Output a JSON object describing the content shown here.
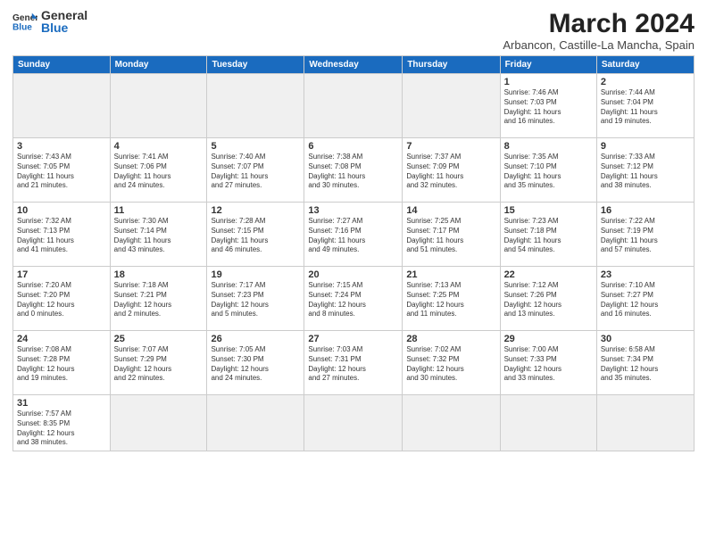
{
  "header": {
    "logo_general": "General",
    "logo_blue": "Blue",
    "month_title": "March 2024",
    "location": "Arbancon, Castille-La Mancha, Spain"
  },
  "weekdays": [
    "Sunday",
    "Monday",
    "Tuesday",
    "Wednesday",
    "Thursday",
    "Friday",
    "Saturday"
  ],
  "weeks": [
    [
      {
        "day": "",
        "info": ""
      },
      {
        "day": "",
        "info": ""
      },
      {
        "day": "",
        "info": ""
      },
      {
        "day": "",
        "info": ""
      },
      {
        "day": "",
        "info": ""
      },
      {
        "day": "1",
        "info": "Sunrise: 7:46 AM\nSunset: 7:03 PM\nDaylight: 11 hours\nand 16 minutes."
      },
      {
        "day": "2",
        "info": "Sunrise: 7:44 AM\nSunset: 7:04 PM\nDaylight: 11 hours\nand 19 minutes."
      }
    ],
    [
      {
        "day": "3",
        "info": "Sunrise: 7:43 AM\nSunset: 7:05 PM\nDaylight: 11 hours\nand 21 minutes."
      },
      {
        "day": "4",
        "info": "Sunrise: 7:41 AM\nSunset: 7:06 PM\nDaylight: 11 hours\nand 24 minutes."
      },
      {
        "day": "5",
        "info": "Sunrise: 7:40 AM\nSunset: 7:07 PM\nDaylight: 11 hours\nand 27 minutes."
      },
      {
        "day": "6",
        "info": "Sunrise: 7:38 AM\nSunset: 7:08 PM\nDaylight: 11 hours\nand 30 minutes."
      },
      {
        "day": "7",
        "info": "Sunrise: 7:37 AM\nSunset: 7:09 PM\nDaylight: 11 hours\nand 32 minutes."
      },
      {
        "day": "8",
        "info": "Sunrise: 7:35 AM\nSunset: 7:10 PM\nDaylight: 11 hours\nand 35 minutes."
      },
      {
        "day": "9",
        "info": "Sunrise: 7:33 AM\nSunset: 7:12 PM\nDaylight: 11 hours\nand 38 minutes."
      }
    ],
    [
      {
        "day": "10",
        "info": "Sunrise: 7:32 AM\nSunset: 7:13 PM\nDaylight: 11 hours\nand 41 minutes."
      },
      {
        "day": "11",
        "info": "Sunrise: 7:30 AM\nSunset: 7:14 PM\nDaylight: 11 hours\nand 43 minutes."
      },
      {
        "day": "12",
        "info": "Sunrise: 7:28 AM\nSunset: 7:15 PM\nDaylight: 11 hours\nand 46 minutes."
      },
      {
        "day": "13",
        "info": "Sunrise: 7:27 AM\nSunset: 7:16 PM\nDaylight: 11 hours\nand 49 minutes."
      },
      {
        "day": "14",
        "info": "Sunrise: 7:25 AM\nSunset: 7:17 PM\nDaylight: 11 hours\nand 51 minutes."
      },
      {
        "day": "15",
        "info": "Sunrise: 7:23 AM\nSunset: 7:18 PM\nDaylight: 11 hours\nand 54 minutes."
      },
      {
        "day": "16",
        "info": "Sunrise: 7:22 AM\nSunset: 7:19 PM\nDaylight: 11 hours\nand 57 minutes."
      }
    ],
    [
      {
        "day": "17",
        "info": "Sunrise: 7:20 AM\nSunset: 7:20 PM\nDaylight: 12 hours\nand 0 minutes."
      },
      {
        "day": "18",
        "info": "Sunrise: 7:18 AM\nSunset: 7:21 PM\nDaylight: 12 hours\nand 2 minutes."
      },
      {
        "day": "19",
        "info": "Sunrise: 7:17 AM\nSunset: 7:23 PM\nDaylight: 12 hours\nand 5 minutes."
      },
      {
        "day": "20",
        "info": "Sunrise: 7:15 AM\nSunset: 7:24 PM\nDaylight: 12 hours\nand 8 minutes."
      },
      {
        "day": "21",
        "info": "Sunrise: 7:13 AM\nSunset: 7:25 PM\nDaylight: 12 hours\nand 11 minutes."
      },
      {
        "day": "22",
        "info": "Sunrise: 7:12 AM\nSunset: 7:26 PM\nDaylight: 12 hours\nand 13 minutes."
      },
      {
        "day": "23",
        "info": "Sunrise: 7:10 AM\nSunset: 7:27 PM\nDaylight: 12 hours\nand 16 minutes."
      }
    ],
    [
      {
        "day": "24",
        "info": "Sunrise: 7:08 AM\nSunset: 7:28 PM\nDaylight: 12 hours\nand 19 minutes."
      },
      {
        "day": "25",
        "info": "Sunrise: 7:07 AM\nSunset: 7:29 PM\nDaylight: 12 hours\nand 22 minutes."
      },
      {
        "day": "26",
        "info": "Sunrise: 7:05 AM\nSunset: 7:30 PM\nDaylight: 12 hours\nand 24 minutes."
      },
      {
        "day": "27",
        "info": "Sunrise: 7:03 AM\nSunset: 7:31 PM\nDaylight: 12 hours\nand 27 minutes."
      },
      {
        "day": "28",
        "info": "Sunrise: 7:02 AM\nSunset: 7:32 PM\nDaylight: 12 hours\nand 30 minutes."
      },
      {
        "day": "29",
        "info": "Sunrise: 7:00 AM\nSunset: 7:33 PM\nDaylight: 12 hours\nand 33 minutes."
      },
      {
        "day": "30",
        "info": "Sunrise: 6:58 AM\nSunset: 7:34 PM\nDaylight: 12 hours\nand 35 minutes."
      }
    ],
    [
      {
        "day": "31",
        "info": "Sunrise: 7:57 AM\nSunset: 8:35 PM\nDaylight: 12 hours\nand 38 minutes."
      },
      {
        "day": "",
        "info": ""
      },
      {
        "day": "",
        "info": ""
      },
      {
        "day": "",
        "info": ""
      },
      {
        "day": "",
        "info": ""
      },
      {
        "day": "",
        "info": ""
      },
      {
        "day": "",
        "info": ""
      }
    ]
  ]
}
